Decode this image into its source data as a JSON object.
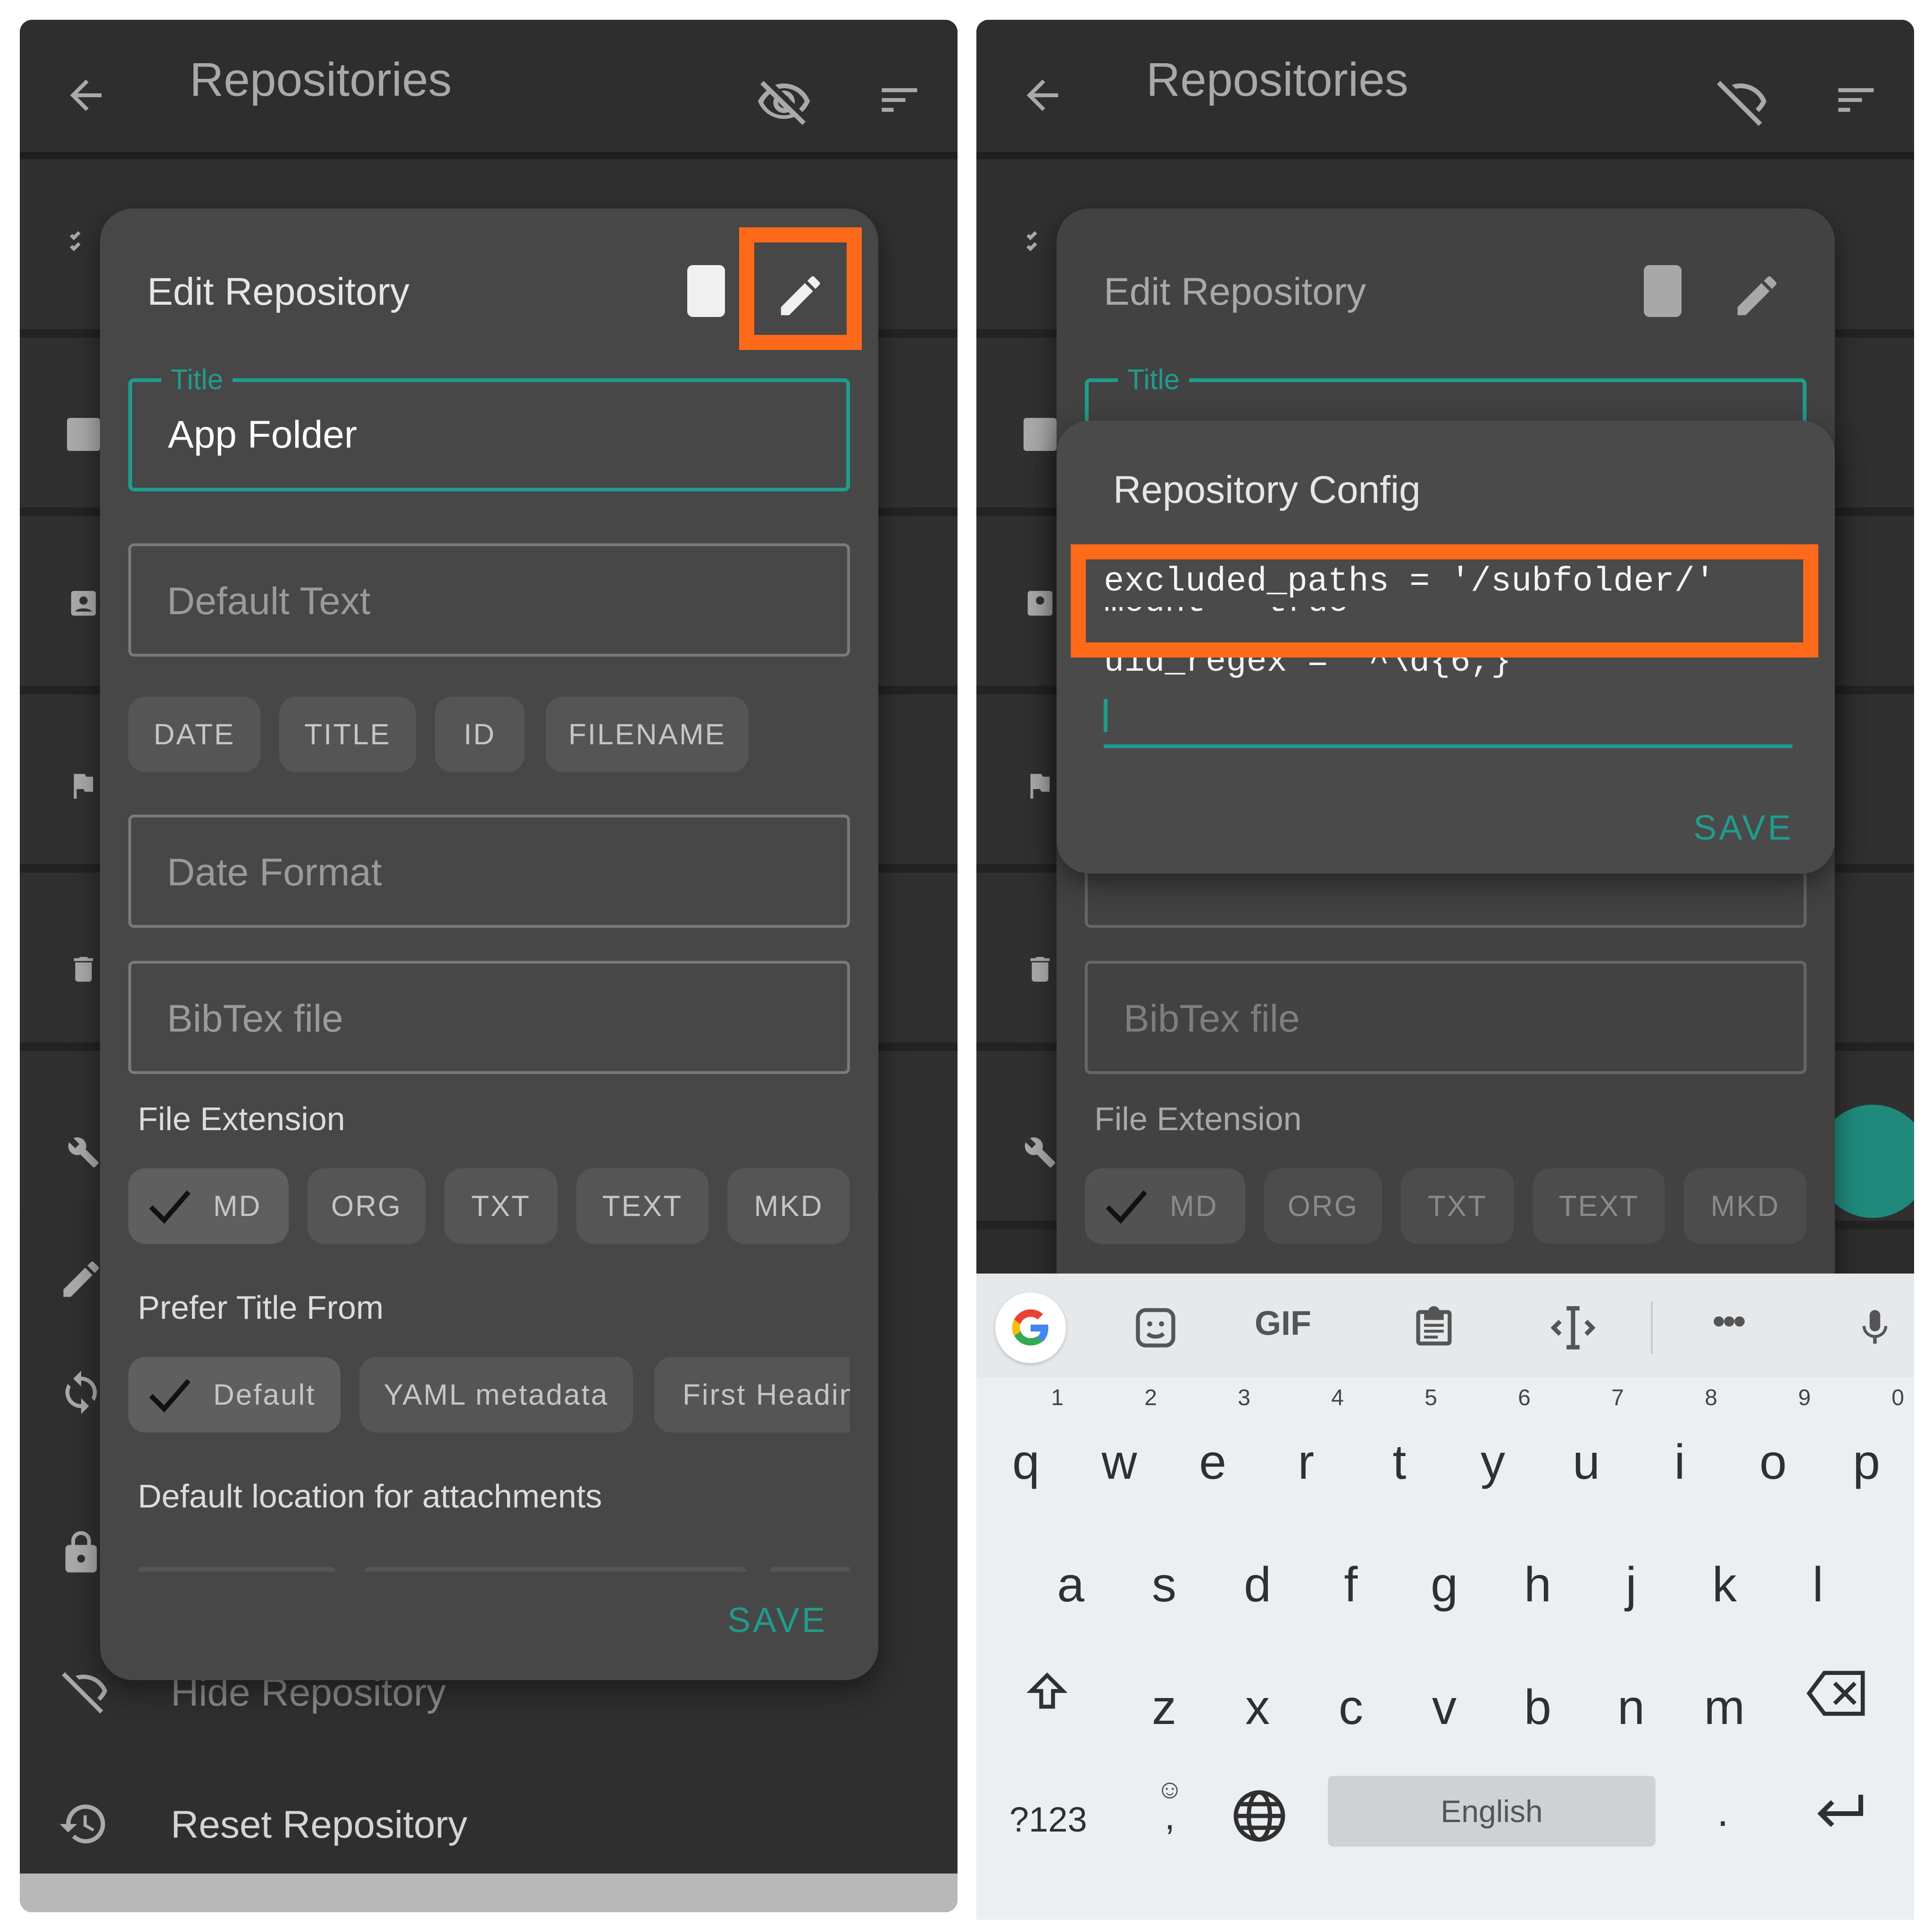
{
  "left": {
    "appbar": {
      "title": "Repositories"
    },
    "dialog": {
      "title": "Edit Repository",
      "fields": {
        "title_legend": "Title",
        "title_value": "App Folder",
        "default_text_placeholder": "Default Text",
        "date_format_placeholder": "Date Format",
        "bibtex_placeholder": "BibTex file"
      },
      "insert_chips": [
        "DATE",
        "TITLE",
        "ID",
        "FILENAME"
      ],
      "file_extension_label": "File Extension",
      "file_extension_chips": [
        "MD",
        "ORG",
        "TXT",
        "TEXT",
        "MKD"
      ],
      "prefer_title_label": "Prefer Title From",
      "prefer_title_chips": [
        "Default",
        "YAML metadata",
        "First Headin"
      ],
      "attachments_label": "Default location for attachments",
      "save_label": "SAVE"
    },
    "sheet": {
      "hide_label": "Hide Repository",
      "reset_label": "Reset Repository"
    }
  },
  "right": {
    "appbar": {
      "title": "Repositories"
    },
    "dialog": {
      "title": "Edit Repository",
      "title_legend": "Title",
      "bibtex_placeholder": "BibTex file",
      "file_extension_label": "File Extension",
      "file_extension_chips": [
        "MD",
        "ORG",
        "TXT",
        "TEXT",
        "MKD"
      ]
    },
    "config_dialog": {
      "title": "Repository Config",
      "line1": "excluded_paths = '/subfolder/'",
      "line2_partial": "mount = true",
      "line3": "uid_regex = '^\\d{6,}'",
      "save_label": "SAVE"
    },
    "keyboard": {
      "row1": [
        "q",
        "w",
        "e",
        "r",
        "t",
        "y",
        "u",
        "i",
        "o",
        "p"
      ],
      "row1_hints": [
        "1",
        "2",
        "3",
        "4",
        "5",
        "6",
        "7",
        "8",
        "9",
        "0"
      ],
      "row2": [
        "a",
        "s",
        "d",
        "f",
        "g",
        "h",
        "j",
        "k",
        "l"
      ],
      "row3": [
        "z",
        "x",
        "c",
        "v",
        "b",
        "n",
        "m"
      ],
      "symbols_label": "?123",
      "comma_label": ",",
      "space_label": "English",
      "period_label": ".",
      "gif_label": "GIF"
    }
  },
  "colors": {
    "accent": "#1f9c8c",
    "highlight": "#ff6a1a",
    "dialog_bg": "#474747",
    "panel_bg": "#2c2c2c"
  }
}
